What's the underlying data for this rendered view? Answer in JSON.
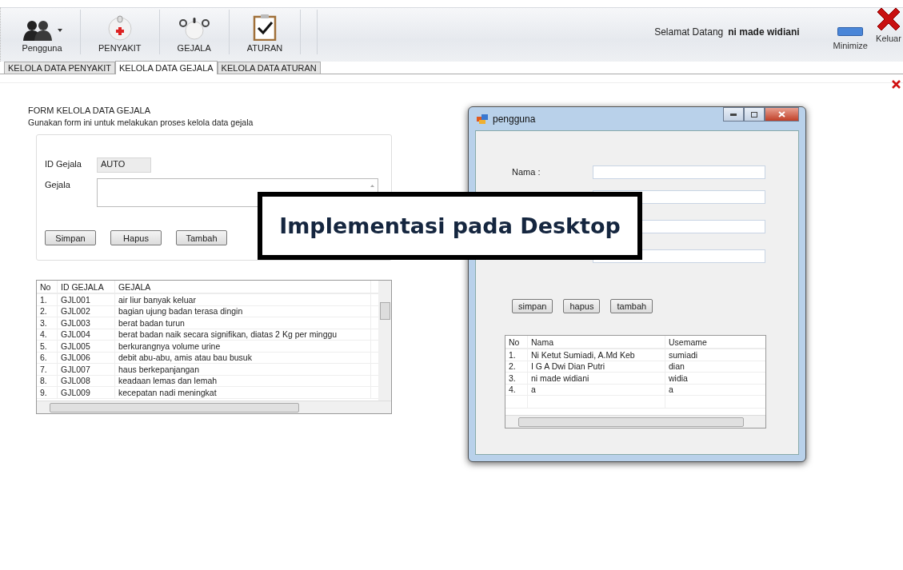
{
  "toolbar": {
    "buttons": [
      {
        "label": "Pengguna",
        "kind": "users",
        "dropdown": true
      },
      {
        "label": "PENYAKIT",
        "kind": "medkit",
        "dropdown": false
      },
      {
        "label": "GEJALA",
        "kind": "stethoscope",
        "dropdown": false
      },
      {
        "label": "ATURAN",
        "kind": "clipboard",
        "dropdown": false
      }
    ],
    "welcome": "Selamat Datang",
    "user": "ni made widiani",
    "minimize": "Minimize",
    "exit": "Keluar"
  },
  "tabs": [
    {
      "label": "KELOLA DATA PENYAKIT",
      "selected": false
    },
    {
      "label": "KELOLA DATA GEJALA",
      "selected": true
    },
    {
      "label": "KELOLA DATA ATURAN",
      "selected": false
    }
  ],
  "form": {
    "title": "FORM KELOLA DATA GEJALA",
    "subtitle": "Gunakan form ini untuk melakukan proses kelola data gejala",
    "id_label": "ID Gejala",
    "id_value": "AUTO",
    "symptom_label": "Gejala",
    "buttons": [
      "Simpan",
      "Hapus",
      "Tambah"
    ]
  },
  "table": {
    "columns": [
      "No",
      "ID GEJALA",
      "GEJALA"
    ],
    "rows": [
      [
        "1.",
        "GJL001",
        "air liur banyak keluar"
      ],
      [
        "2.",
        "GJL002",
        "bagian ujung badan terasa dingin"
      ],
      [
        "3.",
        "GJL003",
        "berat badan turun"
      ],
      [
        "4.",
        "GJL004",
        "berat badan naik secara signifikan, diatas 2 Kg per minggu"
      ],
      [
        "5.",
        "GJL005",
        "berkurangnya volume urine"
      ],
      [
        "6.",
        "GJL006",
        "debit abu-abu, amis atau bau busuk"
      ],
      [
        "7.",
        "GJL007",
        "haus berkepanjangan"
      ],
      [
        "8.",
        "GJL008",
        "keadaan lemas dan lemah"
      ],
      [
        "9.",
        "GJL009",
        "kecepatan nadi meningkat"
      ]
    ]
  },
  "dialog": {
    "title": "pengguna",
    "fields": [
      {
        "kind": "labeled",
        "label": "Nama :"
      },
      {
        "kind": "bare"
      },
      {
        "kind": "bare"
      },
      {
        "kind": "bare"
      }
    ],
    "buttons": [
      "simpan",
      "hapus",
      "tambah"
    ],
    "table": {
      "columns": [
        "No",
        "Nama",
        "Usemame"
      ],
      "rows": [
        [
          "1.",
          "Ni Ketut Sumiadi, A.Md Keb",
          "sumiadi"
        ],
        [
          "2.",
          "I G A Dwi Dian Putri",
          "dian"
        ],
        [
          "3.",
          "ni made widiani",
          "widia"
        ],
        [
          "4.",
          "a",
          "a"
        ]
      ]
    }
  },
  "caption": "Implementasi pada Desktop"
}
